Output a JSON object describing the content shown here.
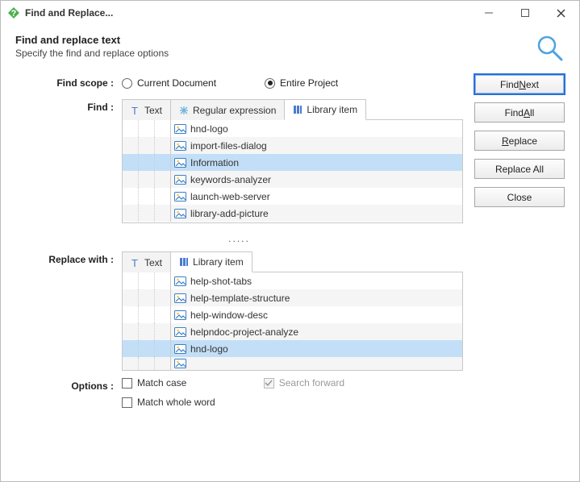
{
  "window": {
    "title": "Find and Replace..."
  },
  "header": {
    "title": "Find and replace text",
    "subtitle": "Specify the find and replace options"
  },
  "labels": {
    "find_scope": "Find scope :",
    "find": "Find :",
    "replace_with": "Replace with :",
    "options": "Options :"
  },
  "scope": {
    "current": "Current Document",
    "entire": "Entire Project",
    "selected": "entire"
  },
  "find_tabs": {
    "text": "Text",
    "regex": "Regular expression",
    "library": "Library item",
    "active": "library"
  },
  "find_items": [
    "hnd-logo",
    "import-files-dialog",
    "Information",
    "keywords-analyzer",
    "launch-web-server",
    "library-add-picture"
  ],
  "find_selected_index": 2,
  "ellipsis": ".....",
  "replace_tabs": {
    "text": "Text",
    "library": "Library item",
    "active": "library"
  },
  "replace_items": [
    "help-shot-tabs",
    "help-template-structure",
    "help-window-desc",
    "helpndoc-project-analyze",
    "hnd-logo"
  ],
  "replace_selected_index": 4,
  "options": {
    "match_case": "Match case",
    "match_whole": "Match whole word",
    "search_forward": "Search forward",
    "match_case_checked": false,
    "match_whole_checked": false,
    "search_forward_checked": true,
    "search_forward_disabled": true
  },
  "buttons": {
    "find_next_pre": "Find ",
    "find_next_ul": "N",
    "find_next_post": "ext",
    "find_all_pre": "Find ",
    "find_all_ul": "A",
    "find_all_post": "ll",
    "replace_ul": "R",
    "replace_post": "eplace",
    "replace_all": "Replace All",
    "close": "Close"
  }
}
